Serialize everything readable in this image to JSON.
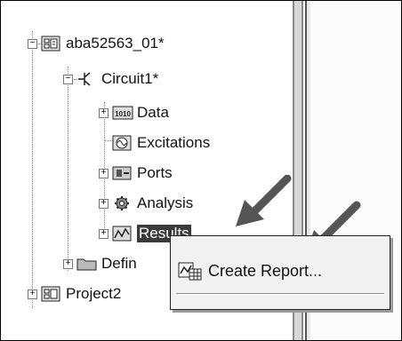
{
  "tree": {
    "project1": {
      "label": "aba52563_01*",
      "expander": "−"
    },
    "circuit1": {
      "label": "Circuit1*",
      "expander": "−"
    },
    "data_node": {
      "label": "Data",
      "expander": "+"
    },
    "excitations": {
      "label": "Excitations"
    },
    "ports": {
      "label": "Ports",
      "expander": "+"
    },
    "analysis": {
      "label": "Analysis",
      "expander": "+"
    },
    "results": {
      "label": "Results",
      "expander": "+"
    },
    "definitions": {
      "label": "Defin",
      "expander": "+"
    },
    "project2": {
      "label": "Project2",
      "expander": "+"
    }
  },
  "context_menu": {
    "create_report_label": "Create Report..."
  },
  "icons": {
    "project": "project-grid-icon",
    "circuit": "circuit-symbol-icon",
    "data": "data-1010-icon",
    "excitations": "excitation-wave-icon",
    "ports": "ports-icon",
    "analysis": "gear-analysis-icon",
    "results": "results-graph-icon",
    "definitions": "folder-icon",
    "report": "report-chart-icon"
  }
}
